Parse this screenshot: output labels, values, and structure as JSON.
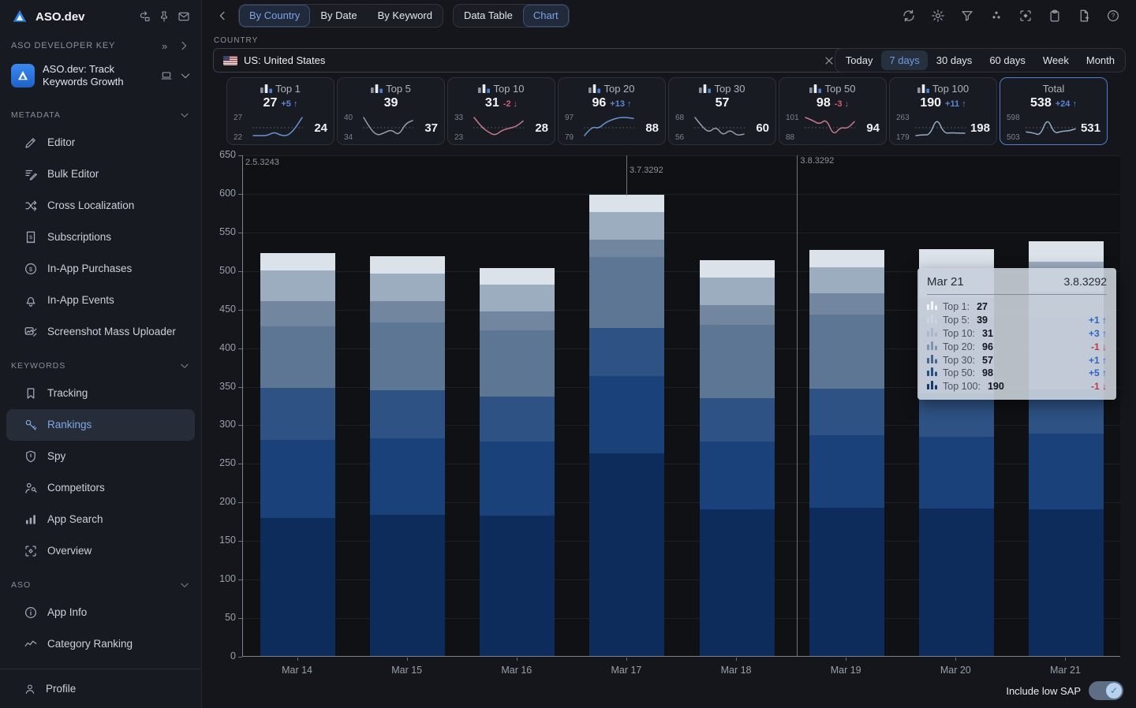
{
  "app": {
    "name": "ASO.dev"
  },
  "colors": {
    "accent_blue": "#5c87d8",
    "up": "#5c87d8",
    "down": "#cf5d72",
    "card_icon_bars": [
      "#8b93a0",
      "#e8ecf2",
      "#4d7fd1"
    ]
  },
  "sidebar": {
    "header": {
      "title": "ASO.dev",
      "icons": [
        "workflow-icon",
        "pin-icon",
        "mail-icon"
      ]
    },
    "developer_key": {
      "label": "ASO DEVELOPER KEY",
      "icons": [
        "double-chevron-right-icon",
        "chevron-right-icon"
      ]
    },
    "app_item": {
      "title": "ASO.dev: Track Keywords Growth",
      "icons": [
        "laptop-icon",
        "chevron-down-icon"
      ]
    },
    "sections": [
      {
        "label": "METADATA",
        "items": [
          {
            "label": "Editor",
            "icon": "pencil-icon"
          },
          {
            "label": "Bulk Editor",
            "icon": "bulk-editor-icon"
          },
          {
            "label": "Cross Localization",
            "icon": "cross-localization-icon"
          },
          {
            "label": "Subscriptions",
            "icon": "receipt-icon"
          },
          {
            "label": "In-App Purchases",
            "icon": "dollar-circle-icon"
          },
          {
            "label": "In-App Events",
            "icon": "bell-icon"
          },
          {
            "label": "Screenshot Mass Uploader",
            "icon": "screenshot-upload-icon"
          }
        ]
      },
      {
        "label": "KEYWORDS",
        "items": [
          {
            "label": "Tracking",
            "icon": "bookmark-icon"
          },
          {
            "label": "Rankings",
            "icon": "key-icon",
            "active": true
          },
          {
            "label": "Spy",
            "icon": "shield-icon"
          },
          {
            "label": "Competitors",
            "icon": "competitors-icon"
          },
          {
            "label": "App Search",
            "icon": "bar-chart-icon"
          },
          {
            "label": "Overview",
            "icon": "focus-icon"
          }
        ]
      },
      {
        "label": "ASO",
        "items": [
          {
            "label": "App Info",
            "icon": "info-icon"
          },
          {
            "label": "Category Ranking",
            "icon": "trend-icon"
          }
        ]
      }
    ],
    "footer": {
      "label": "Profile",
      "icon": "person-icon"
    }
  },
  "topbar": {
    "back_icon": "back-icon",
    "tab_groups": [
      {
        "tabs": [
          {
            "label": "By Country",
            "active": true
          },
          {
            "label": "By Date",
            "active": false
          },
          {
            "label": "By Keyword",
            "active": false
          }
        ]
      },
      {
        "tabs": [
          {
            "label": "Data Table",
            "active": false
          },
          {
            "label": "Chart",
            "active": true
          }
        ]
      }
    ],
    "action_icons": [
      "refresh-icon",
      "gear-icon",
      "filter-icon",
      "dots-icon",
      "scan-icon",
      "clipboard-icon",
      "document-add-icon",
      "help-icon"
    ]
  },
  "filters": {
    "country_label": "COUNTRY",
    "country_value": "US: United States",
    "country_icons": [
      "close-icon",
      "chevron-down-icon"
    ],
    "ranges": [
      {
        "label": "Today",
        "active": false
      },
      {
        "label": "7 days",
        "active": true
      },
      {
        "label": "30 days",
        "active": false
      },
      {
        "label": "60 days",
        "active": false
      },
      {
        "label": "Week",
        "active": false
      },
      {
        "label": "Month",
        "active": false
      }
    ]
  },
  "cards": [
    {
      "label": "Top 1",
      "value": "27",
      "change": "+5",
      "dir": "up",
      "max": "27",
      "min": "22",
      "end": "24",
      "color": "#6b93d6",
      "spark": [
        22,
        22,
        22,
        23,
        22,
        22,
        24,
        27
      ],
      "selected": false
    },
    {
      "label": "Top 5",
      "value": "39",
      "change": "",
      "dir": "",
      "max": "40",
      "min": "34",
      "end": "37",
      "color": "#959ca8",
      "spark": [
        40,
        36,
        34,
        35,
        36,
        34,
        38,
        39
      ],
      "selected": false
    },
    {
      "label": "Top 10",
      "value": "31",
      "change": "-2",
      "dir": "down",
      "max": "33",
      "min": "23",
      "end": "28",
      "color": "#c57a8e",
      "spark": [
        33,
        28,
        25,
        23,
        26,
        27,
        28,
        31
      ],
      "selected": false
    },
    {
      "label": "Top 20",
      "value": "96",
      "change": "+13",
      "dir": "up",
      "max": "97",
      "min": "79",
      "end": "88",
      "color": "#6b93d6",
      "spark": [
        79,
        88,
        86,
        92,
        95,
        97,
        97,
        96
      ],
      "selected": false
    },
    {
      "label": "Top 30",
      "value": "57",
      "change": "",
      "dir": "",
      "max": "68",
      "min": "56",
      "end": "60",
      "color": "#959ca8",
      "spark": [
        68,
        62,
        58,
        62,
        56,
        60,
        56,
        57
      ],
      "selected": false
    },
    {
      "label": "Top 50",
      "value": "98",
      "change": "-3",
      "dir": "down",
      "max": "101",
      "min": "88",
      "end": "94",
      "color": "#c57a8e",
      "spark": [
        101,
        99,
        96,
        100,
        88,
        94,
        93,
        98
      ],
      "selected": false
    },
    {
      "label": "Top 100",
      "value": "190",
      "change": "+11",
      "dir": "up",
      "max": "263",
      "min": "179",
      "end": "198",
      "color": "#93abc9",
      "spark": [
        179,
        183,
        182,
        263,
        190,
        192,
        191,
        190
      ],
      "selected": false
    },
    {
      "label": "Total",
      "value": "538",
      "change": "+24",
      "dir": "up",
      "max": "598",
      "min": "503",
      "end": "531",
      "color": "#93abc9",
      "spark": [
        522,
        518,
        503,
        598,
        513,
        526,
        527,
        538
      ],
      "selected": true
    }
  ],
  "chart_data": {
    "type": "stacked-bar",
    "x": [
      "Mar 14",
      "Mar 15",
      "Mar 16",
      "Mar 17",
      "Mar 18",
      "Mar 19",
      "Mar 20",
      "Mar 21"
    ],
    "ylim": [
      0,
      650
    ],
    "ytick_step": 50,
    "grid": "horizontal",
    "series": [
      {
        "name": "Top 100",
        "color": "#0d2c5c",
        "values": [
          179,
          183,
          182,
          263,
          190,
          192,
          191,
          190
        ]
      },
      {
        "name": "Top 50",
        "color": "#1a4179",
        "values": [
          101,
          99,
          96,
          100,
          88,
          94,
          93,
          98
        ]
      },
      {
        "name": "Top 30",
        "color": "#2e5284",
        "values": [
          68,
          62,
          58,
          62,
          56,
          60,
          56,
          57
        ]
      },
      {
        "name": "Top 20",
        "color": "#5d7694",
        "values": [
          79,
          88,
          86,
          92,
          95,
          97,
          97,
          96
        ]
      },
      {
        "name": "Top 10",
        "color": "#72869f",
        "values": [
          33,
          28,
          25,
          23,
          26,
          27,
          28,
          31
        ]
      },
      {
        "name": "Top 5",
        "color": "#9dadc0",
        "values": [
          40,
          36,
          34,
          35,
          36,
          34,
          38,
          39
        ]
      },
      {
        "name": "Top 1",
        "color": "#dbe2ea",
        "values": [
          22,
          22,
          22,
          23,
          22,
          22,
          24,
          27
        ]
      }
    ],
    "annotations": [
      {
        "label": "2.5.3243",
        "style": "label-only",
        "x_index": 0
      },
      {
        "label": "3.7.3292",
        "style": "line-to-bar",
        "x_index": 3
      },
      {
        "label": "3.8.3292",
        "style": "full-line",
        "x_frac": 0.632
      }
    ]
  },
  "tooltip": {
    "date": "Mar 21",
    "version": "3.8.3292",
    "rows": [
      {
        "label": "Top 1",
        "value": "27",
        "delta": "",
        "dir": "",
        "color": "#f4f7fa"
      },
      {
        "label": "Top 5",
        "value": "39",
        "delta": "+1",
        "dir": "up",
        "color": "#ccd6e0"
      },
      {
        "label": "Top 10",
        "value": "31",
        "delta": "+3",
        "dir": "up",
        "color": "#a9b8c8"
      },
      {
        "label": "Top 20",
        "value": "96",
        "delta": "-1",
        "dir": "down",
        "color": "#7e95ad"
      },
      {
        "label": "Top 30",
        "value": "57",
        "delta": "+1",
        "dir": "up",
        "color": "#46648e"
      },
      {
        "label": "Top 50",
        "value": "98",
        "delta": "+5",
        "dir": "up",
        "color": "#274e82"
      },
      {
        "label": "Top 100",
        "value": "190",
        "delta": "-1",
        "dir": "down",
        "color": "#133a6d"
      }
    ]
  },
  "footer": {
    "toggle_label": "Include low SAP",
    "toggle_on": true
  }
}
